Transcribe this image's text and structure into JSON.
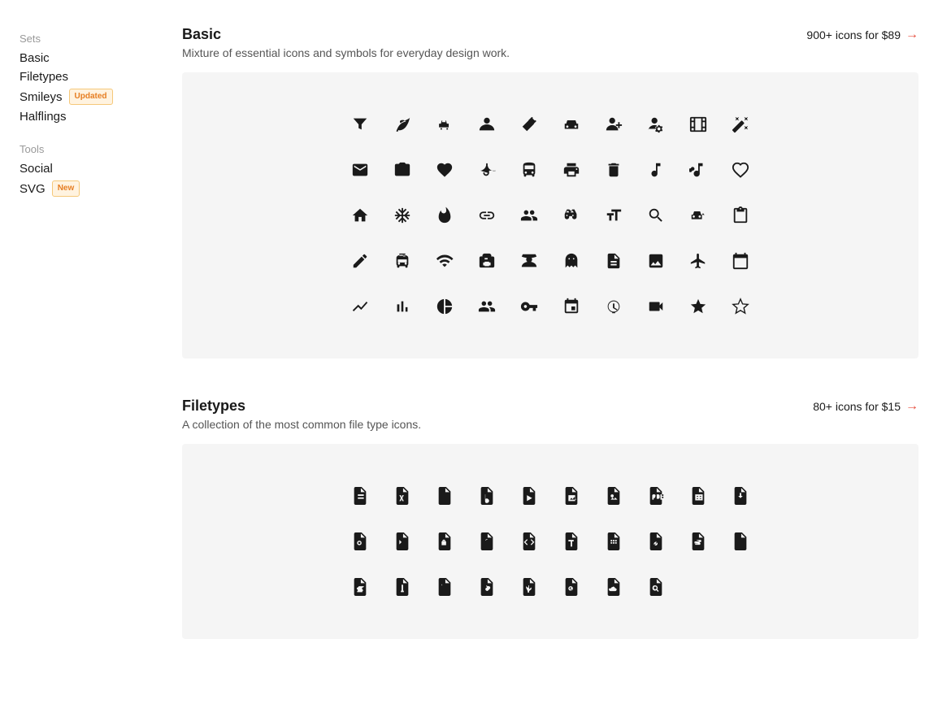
{
  "sidebar": {
    "sets_label": "Sets",
    "tools_label": "Tools",
    "items_sets": [
      {
        "id": "basic",
        "label": "Basic",
        "badge": null
      },
      {
        "id": "filetypes",
        "label": "Filetypes",
        "badge": null
      },
      {
        "id": "smileys",
        "label": "Smileys",
        "badge": "Updated",
        "badge_type": "updated"
      },
      {
        "id": "halflings",
        "label": "Halflings",
        "badge": null
      }
    ],
    "items_tools": [
      {
        "id": "social",
        "label": "Social",
        "badge": null
      },
      {
        "id": "svg",
        "label": "SVG",
        "badge": "New",
        "badge_type": "new"
      }
    ]
  },
  "sections": [
    {
      "id": "basic",
      "title": "Basic",
      "description": "Mixture of essential icons and symbols for everyday design work.",
      "link_label": "900+ icons for $89",
      "icons_rows": [
        [
          "▼",
          "🌿",
          "🐕",
          "👤",
          "🔧",
          "🚗",
          "👤+",
          "👤⚙",
          "🎞",
          "✨"
        ],
        [
          "✉",
          "📷",
          "❤",
          "☂",
          "🚌",
          "🖨",
          "🗑",
          "♪",
          "♫",
          "❤"
        ],
        [
          "🏠",
          "❄",
          "🔥",
          "🧲",
          "👥",
          "👓",
          "🅰",
          "🔍",
          "🚗",
          "📋"
        ],
        [
          "✏",
          "🚌",
          "📡",
          "🎒",
          "🤠",
          "👤",
          "📄",
          "🖼",
          "✈",
          "📅"
        ],
        [
          "📉",
          "📊",
          "🥧",
          "👥",
          "🔑",
          "📅",
          "📡",
          "📹",
          "★",
          "☆"
        ]
      ]
    },
    {
      "id": "filetypes",
      "title": "Filetypes",
      "description": "A collection of the most common file type icons.",
      "link_label": "80+ icons for $15",
      "icons_rows": [
        [
          "📄",
          "📋",
          "📄",
          "📄",
          "▶",
          "🖼",
          "📷",
          "📄",
          "📰",
          "📄"
        ],
        [
          "⚙📄",
          "📄",
          "📄",
          "📄",
          "</>",
          "📄",
          "T",
          "📄",
          "📄",
          "📄"
        ],
        [
          "📄",
          "〰",
          "📦",
          "🗜",
          "❤",
          "📄",
          "🚫",
          "☁",
          "🔍",
          ""
        ]
      ]
    }
  ],
  "icons": {
    "basic_row1": [
      "⚗",
      "🍃",
      "🐕",
      "👤",
      "🔨",
      "🚗",
      "👤",
      "👤",
      "🎬",
      "✨"
    ],
    "basic_row2": [
      "✉",
      "📷",
      "♥",
      "☂",
      "🚍",
      "🖨",
      "🗑",
      "♩",
      "♫",
      "♡"
    ],
    "basic_row3": [
      "🏠",
      "✳",
      "🔥",
      "🧲",
      "👥",
      "👓",
      "🔤",
      "🔍",
      "🚘",
      "📋"
    ],
    "basic_row4": [
      "✏",
      "🚎",
      "📡",
      "🎒",
      "🎩",
      "👤",
      "📄",
      "🖼",
      "✈",
      "📆"
    ],
    "basic_row5": [
      "📉",
      "📊",
      "◔",
      "👥",
      "🗝",
      "📅",
      "📡",
      "📹",
      "★",
      "☆"
    ]
  }
}
